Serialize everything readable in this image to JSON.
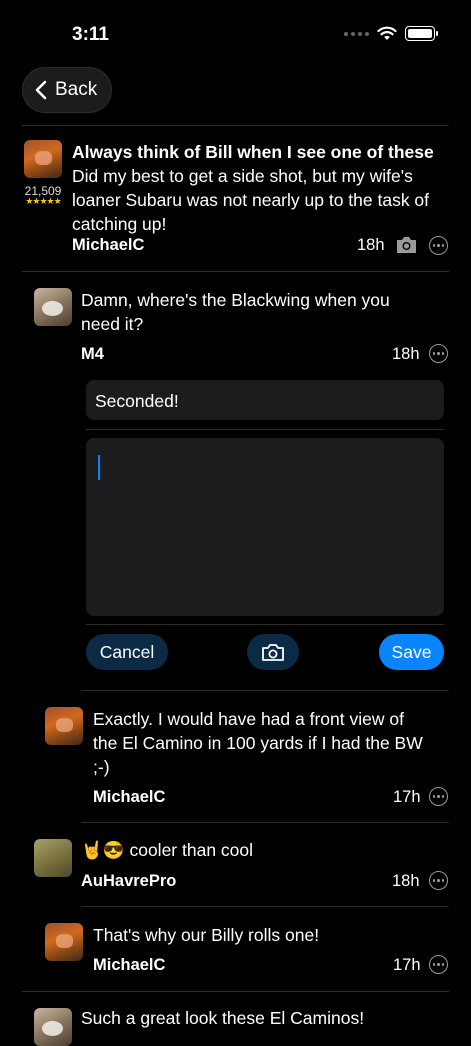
{
  "status": {
    "time": "3:11"
  },
  "nav": {
    "back_label": "Back"
  },
  "post": {
    "title": "Always think of Bill when I see one of these",
    "body": "Did my best to get a side shot, but my wife's loaner Subaru was not nearly up to the task of catching up!",
    "author": "MichaelC",
    "time": "18h",
    "score": "21,509",
    "stars": "★★★★★"
  },
  "reply_m4": {
    "body": "Damn, where's the Blackwing when you need it?",
    "author": "M4",
    "time": "18h"
  },
  "compose": {
    "quick_reply": "Seconded!",
    "cancel_label": "Cancel",
    "save_label": "Save"
  },
  "replies": [
    {
      "body": "Exactly.  I would have had a front view of the El Camino in 100 yards if I had the BW ;-)",
      "author": "MichaelC",
      "time": "17h"
    },
    {
      "emoji": "🤘😎",
      "body": "cooler than cool",
      "author": "AuHavrePro",
      "time": "18h"
    },
    {
      "body": "That's why our Billy rolls one!",
      "author": "MichaelC",
      "time": "17h"
    },
    {
      "body": "Such a great look these El Caminos!"
    }
  ],
  "colors": {
    "accent": "#0a84ff",
    "dark_pill": "#0b2a46",
    "background": "#000000"
  }
}
